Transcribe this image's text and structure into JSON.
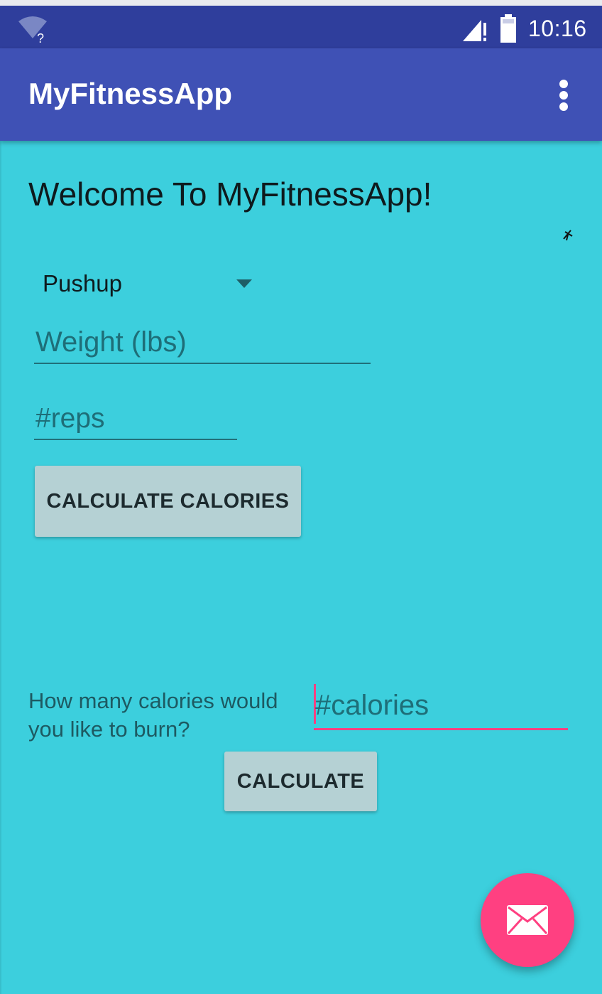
{
  "status_bar": {
    "time": "10:16",
    "wifi_icon": "wifi-unknown-icon",
    "signal_icon": "cell-signal-icon",
    "battery_icon": "battery-icon",
    "background_color": "#2f3e9c"
  },
  "app_bar": {
    "title": "MyFitnessApp",
    "overflow_icon": "more-vert-icon",
    "background_color": "#3f51b5"
  },
  "content": {
    "background_color": "#3ccfdd",
    "welcome_text": "Welcome To MyFitnessApp!",
    "exercise_select": {
      "selected": "Pushup",
      "arrow_icon": "dropdown-arrow-icon"
    },
    "weight_field": {
      "placeholder": "Weight (lbs)",
      "value": ""
    },
    "reps_field": {
      "placeholder": "#reps",
      "value": ""
    },
    "calculate_calories_button": "CALCULATE CALORIES",
    "burn_question": "How many calories would you like to burn?",
    "calories_field": {
      "placeholder": "#calories",
      "value": "",
      "focused": true
    },
    "calculate_button": "CALCULATE"
  },
  "fab": {
    "icon": "email-icon",
    "color": "#ff4081"
  }
}
